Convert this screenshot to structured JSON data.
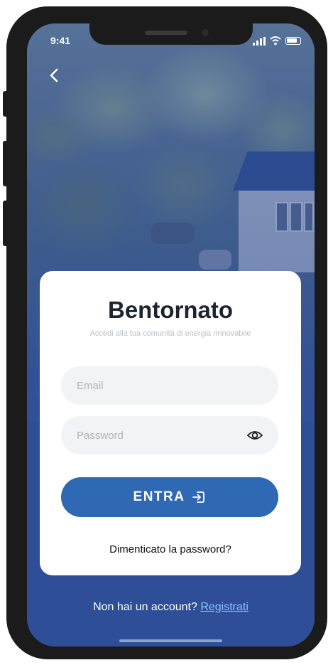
{
  "status_bar": {
    "time": "9:41"
  },
  "login": {
    "title": "Bentornato",
    "subtitle": "Accedi alla tua comunità di energia rinnovabile",
    "email_placeholder": "Email",
    "password_placeholder": "Password",
    "submit_label": "ENTRA",
    "forgot_password": "Dimenticato la password?"
  },
  "footer": {
    "prompt": "Non hai un account?",
    "signup_link": "Registrati"
  },
  "icons": {
    "back": "chevron-left-icon",
    "show_password": "eye-icon",
    "submit": "login-icon"
  },
  "colors": {
    "primary_button": "#2f68b3",
    "background_blue": "#2e4e98",
    "link": "#8fc0ff",
    "title_text": "#1d2430"
  }
}
